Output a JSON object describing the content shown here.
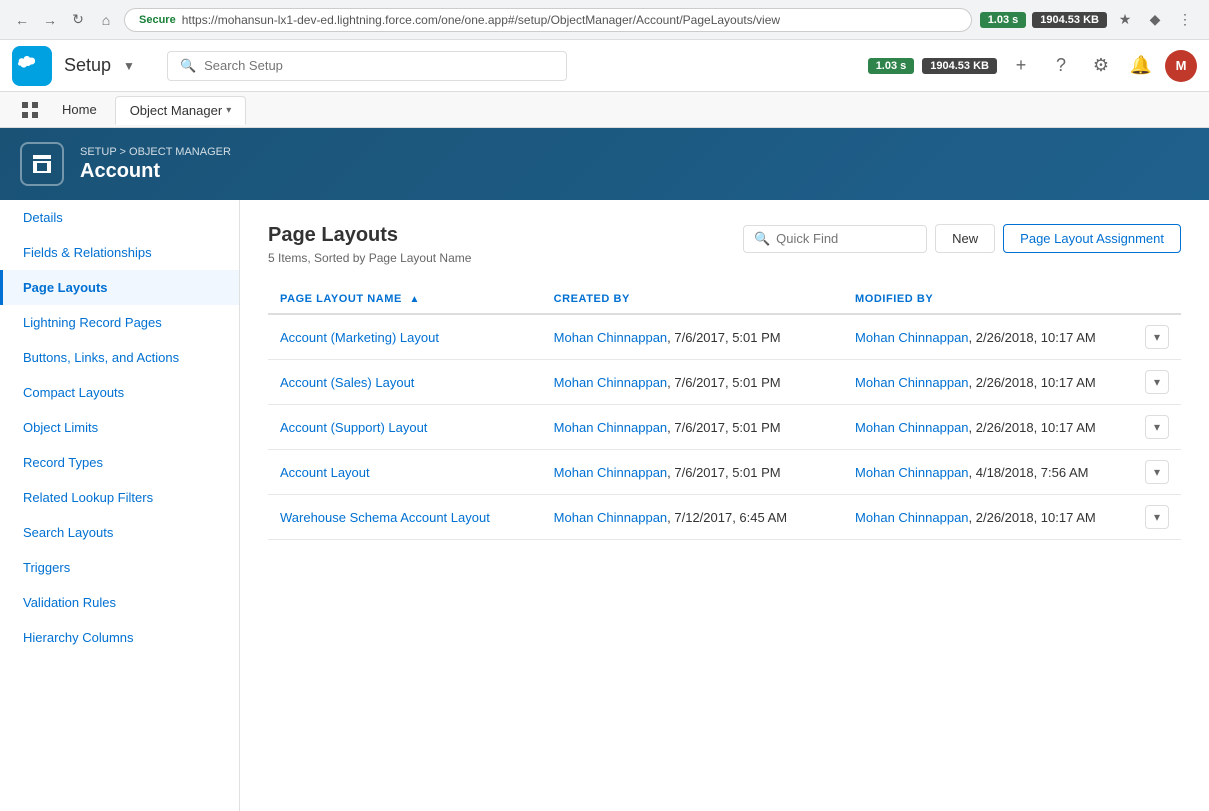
{
  "browser": {
    "url": "https://mohansun-lx1-dev-ed.lightning.force.com/one/one.app#/setup/ObjectManager/Account/PageLayouts/view",
    "secure_label": "Secure",
    "perf": "1.03 s",
    "size": "1904.53 KB"
  },
  "header": {
    "search_placeholder": "Search Setup",
    "app_name": "Setup",
    "app_chevron": "▾"
  },
  "nav": {
    "home_label": "Home",
    "object_manager_label": "Object Manager",
    "object_manager_chevron": "▾"
  },
  "breadcrumb": {
    "setup": "SETUP",
    "separator": ">",
    "object_manager": "OBJECT MANAGER"
  },
  "object": {
    "title": "Account"
  },
  "sidebar": {
    "items": [
      {
        "label": "Details",
        "active": false,
        "link": true
      },
      {
        "label": "Fields & Relationships",
        "active": false,
        "link": true
      },
      {
        "label": "Page Layouts",
        "active": true,
        "link": true
      },
      {
        "label": "Lightning Record Pages",
        "active": false,
        "link": true
      },
      {
        "label": "Buttons, Links, and Actions",
        "active": false,
        "link": true
      },
      {
        "label": "Compact Layouts",
        "active": false,
        "link": true
      },
      {
        "label": "Object Limits",
        "active": false,
        "link": true
      },
      {
        "label": "Record Types",
        "active": false,
        "link": true
      },
      {
        "label": "Related Lookup Filters",
        "active": false,
        "link": true
      },
      {
        "label": "Search Layouts",
        "active": false,
        "link": true
      },
      {
        "label": "Triggers",
        "active": false,
        "link": true
      },
      {
        "label": "Validation Rules",
        "active": false,
        "link": true
      },
      {
        "label": "Hierarchy Columns",
        "active": false,
        "link": true
      }
    ]
  },
  "page_layouts": {
    "title": "Page Layouts",
    "subtitle": "5 Items, Sorted by Page Layout Name",
    "quick_find_placeholder": "Quick Find",
    "new_button": "New",
    "assignment_button": "Page Layout Assignment",
    "columns": [
      {
        "key": "name",
        "label": "PAGE LAYOUT NAME",
        "sortable": true
      },
      {
        "key": "created_by",
        "label": "CREATED BY",
        "sortable": false
      },
      {
        "key": "modified_by",
        "label": "MODIFIED BY",
        "sortable": false
      }
    ],
    "rows": [
      {
        "name": "Account (Marketing) Layout",
        "created_by_user": "Mohan Chinnappan",
        "created_date": ", 7/6/2017, 5:01 PM",
        "modified_by_user": "Mohan Chinnappan",
        "modified_date": ", 2/26/2018, 10:17 AM"
      },
      {
        "name": "Account (Sales) Layout",
        "created_by_user": "Mohan Chinnappan",
        "created_date": ", 7/6/2017, 5:01 PM",
        "modified_by_user": "Mohan Chinnappan",
        "modified_date": ", 2/26/2018, 10:17 AM"
      },
      {
        "name": "Account (Support) Layout",
        "created_by_user": "Mohan Chinnappan",
        "created_date": ", 7/6/2017, 5:01 PM",
        "modified_by_user": "Mohan Chinnappan",
        "modified_date": ", 2/26/2018, 10:17 AM"
      },
      {
        "name": "Account Layout",
        "created_by_user": "Mohan Chinnappan",
        "created_date": ", 7/6/2017, 5:01 PM",
        "modified_by_user": "Mohan Chinnappan",
        "modified_date": ", 4/18/2018, 7:56 AM"
      },
      {
        "name": "Warehouse Schema Account Layout",
        "created_by_user": "Mohan Chinnappan",
        "created_date": ", 7/12/2017, 6:45 AM",
        "modified_by_user": "Mohan Chinnappan",
        "modified_date": ", 2/26/2018, 10:17 AM"
      }
    ]
  }
}
